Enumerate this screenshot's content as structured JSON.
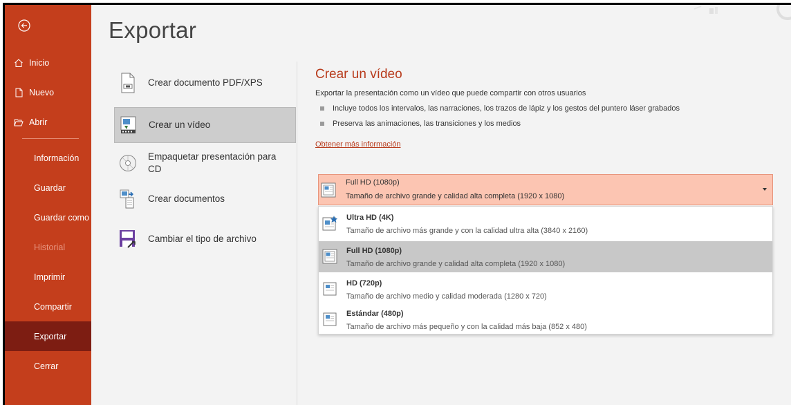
{
  "sidebar": {
    "top_items": [
      {
        "label": "Inicio"
      },
      {
        "label": "Nuevo"
      },
      {
        "label": "Abrir"
      }
    ],
    "items": [
      {
        "label": "Información"
      },
      {
        "label": "Guardar"
      },
      {
        "label": "Guardar como"
      },
      {
        "label": "Historial"
      },
      {
        "label": "Imprimir"
      },
      {
        "label": "Compartir"
      },
      {
        "label": "Exportar"
      },
      {
        "label": "Cerrar"
      }
    ],
    "active": "Exportar",
    "disabled": "Historial"
  },
  "page": {
    "title": "Exportar"
  },
  "export_options": [
    {
      "label": "Crear documento PDF/XPS",
      "icon": "pdf-document-icon"
    },
    {
      "label": "Crear un vídeo",
      "icon": "video-icon"
    },
    {
      "label": "Empaquetar presentación para CD",
      "icon": "cd-icon"
    },
    {
      "label": "Crear documentos",
      "icon": "handouts-icon"
    },
    {
      "label": "Cambiar el tipo de archivo",
      "icon": "save-file-type-icon"
    }
  ],
  "video": {
    "title": "Crear un vídeo",
    "description": "Exportar la presentación como un vídeo que puede compartir con otros usuarios",
    "bullets": [
      "Incluye todos los intervalos, las narraciones, los trazos de lápiz y los gestos del puntero láser grabados",
      "Preserva las animaciones, las transiciones y los medios"
    ],
    "link": "Obtener más información"
  },
  "quality_dropdown": {
    "selected_name": "Full HD (1080p)",
    "selected_desc": "Tamaño de archivo grande y calidad alta completa (1920 x 1080)",
    "options": [
      {
        "name": "Ultra HD (4K)",
        "desc": "Tamaño de archivo más grande y con la calidad ultra alta (3840 x 2160)"
      },
      {
        "name": "Full HD (1080p)",
        "desc": "Tamaño de archivo grande y calidad alta completa (1920 x 1080)"
      },
      {
        "name": "HD (720p)",
        "desc": "Tamaño de archivo medio y calidad moderada (1280 x 720)"
      },
      {
        "name": "Estándar (480p)",
        "desc": "Tamaño de archivo más pequeño y con la calidad más baja (852 x 480)"
      }
    ],
    "highlighted_index": 1
  },
  "colors": {
    "sidebar": "#c43e1c",
    "sidebar_active": "#7d1d12",
    "accent_text": "#b83b1c",
    "dropdown_selected": "#fcc5b2"
  }
}
